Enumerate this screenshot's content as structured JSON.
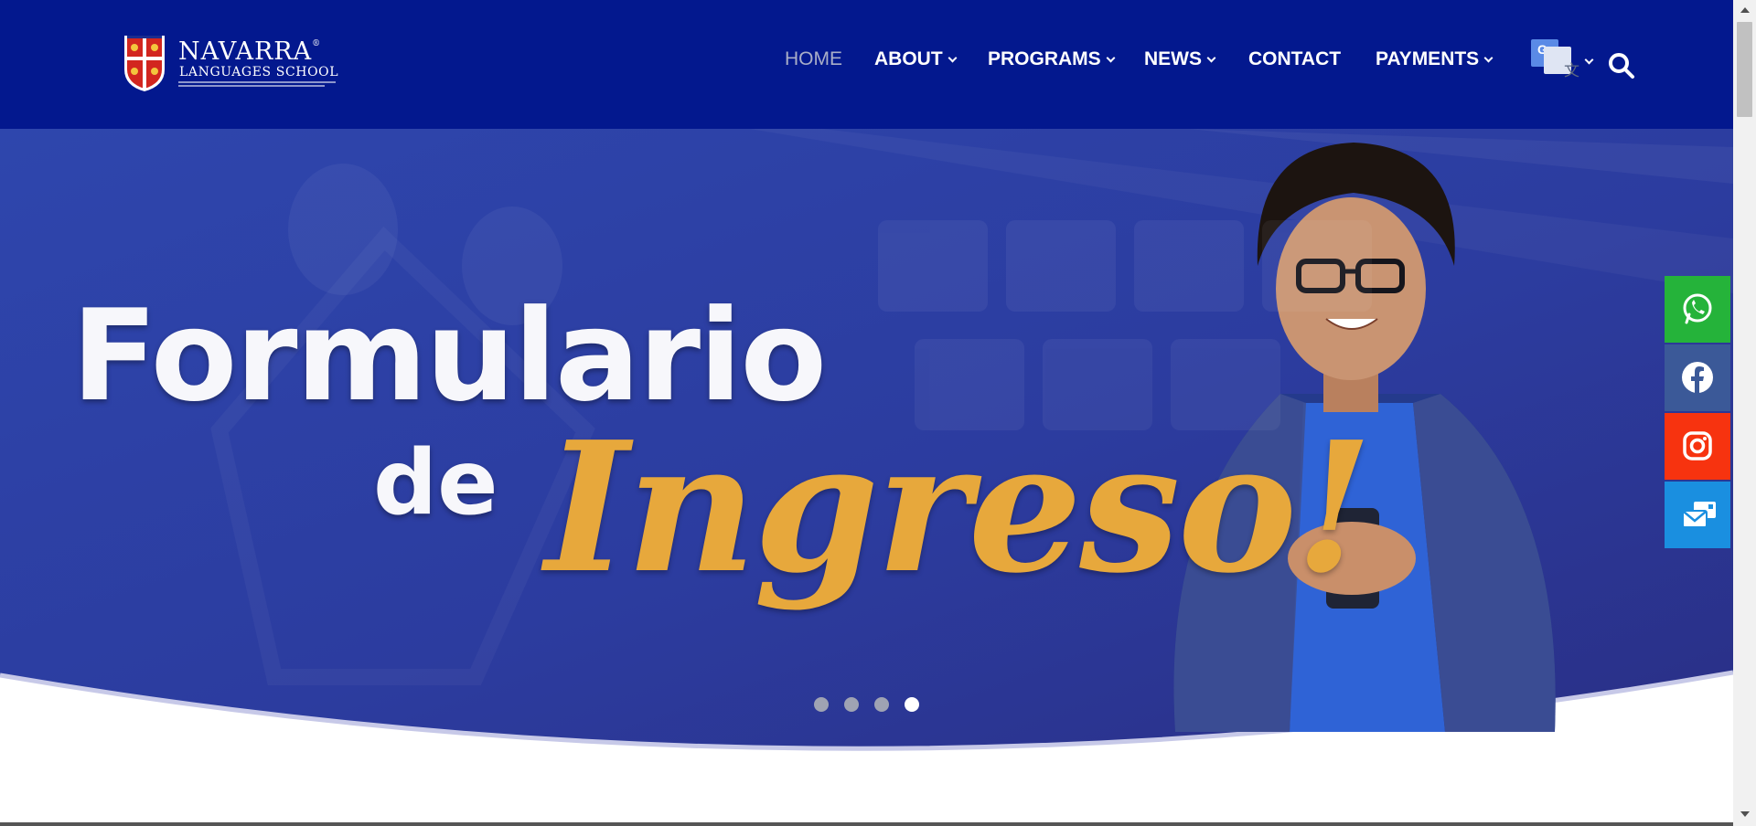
{
  "header": {
    "logo": {
      "brand": "NAVARRA",
      "registered": "®",
      "subtitle": "LANGUAGES SCHOOL"
    },
    "nav": [
      {
        "label": "HOME",
        "active": true,
        "has_dropdown": false
      },
      {
        "label": "ABOUT",
        "active": false,
        "has_dropdown": true
      },
      {
        "label": "PROGRAMS",
        "active": false,
        "has_dropdown": true
      },
      {
        "label": "NEWS",
        "active": false,
        "has_dropdown": true
      },
      {
        "label": "CONTACT",
        "active": false,
        "has_dropdown": false
      },
      {
        "label": "PAYMENTS",
        "active": false,
        "has_dropdown": true
      }
    ],
    "translate_icon": "google-translate-icon",
    "search_icon": "search-icon"
  },
  "hero": {
    "line1": "Formulario",
    "line2": "de",
    "line3": "Ingreso!",
    "slides": 4,
    "active_slide": 4
  },
  "social": [
    {
      "name": "whatsapp",
      "icon": "whatsapp-icon",
      "color": "#25b33a"
    },
    {
      "name": "facebook",
      "icon": "facebook-icon",
      "color": "#3b5998"
    },
    {
      "name": "instagram",
      "icon": "instagram-icon",
      "color": "#f7330f"
    },
    {
      "name": "contact",
      "icon": "mail-icon",
      "color": "#1a8fe0"
    }
  ],
  "colors": {
    "header_bg": "#03188e",
    "hero_bg": "#2f43a5",
    "accent_gold": "#e7a83c"
  }
}
